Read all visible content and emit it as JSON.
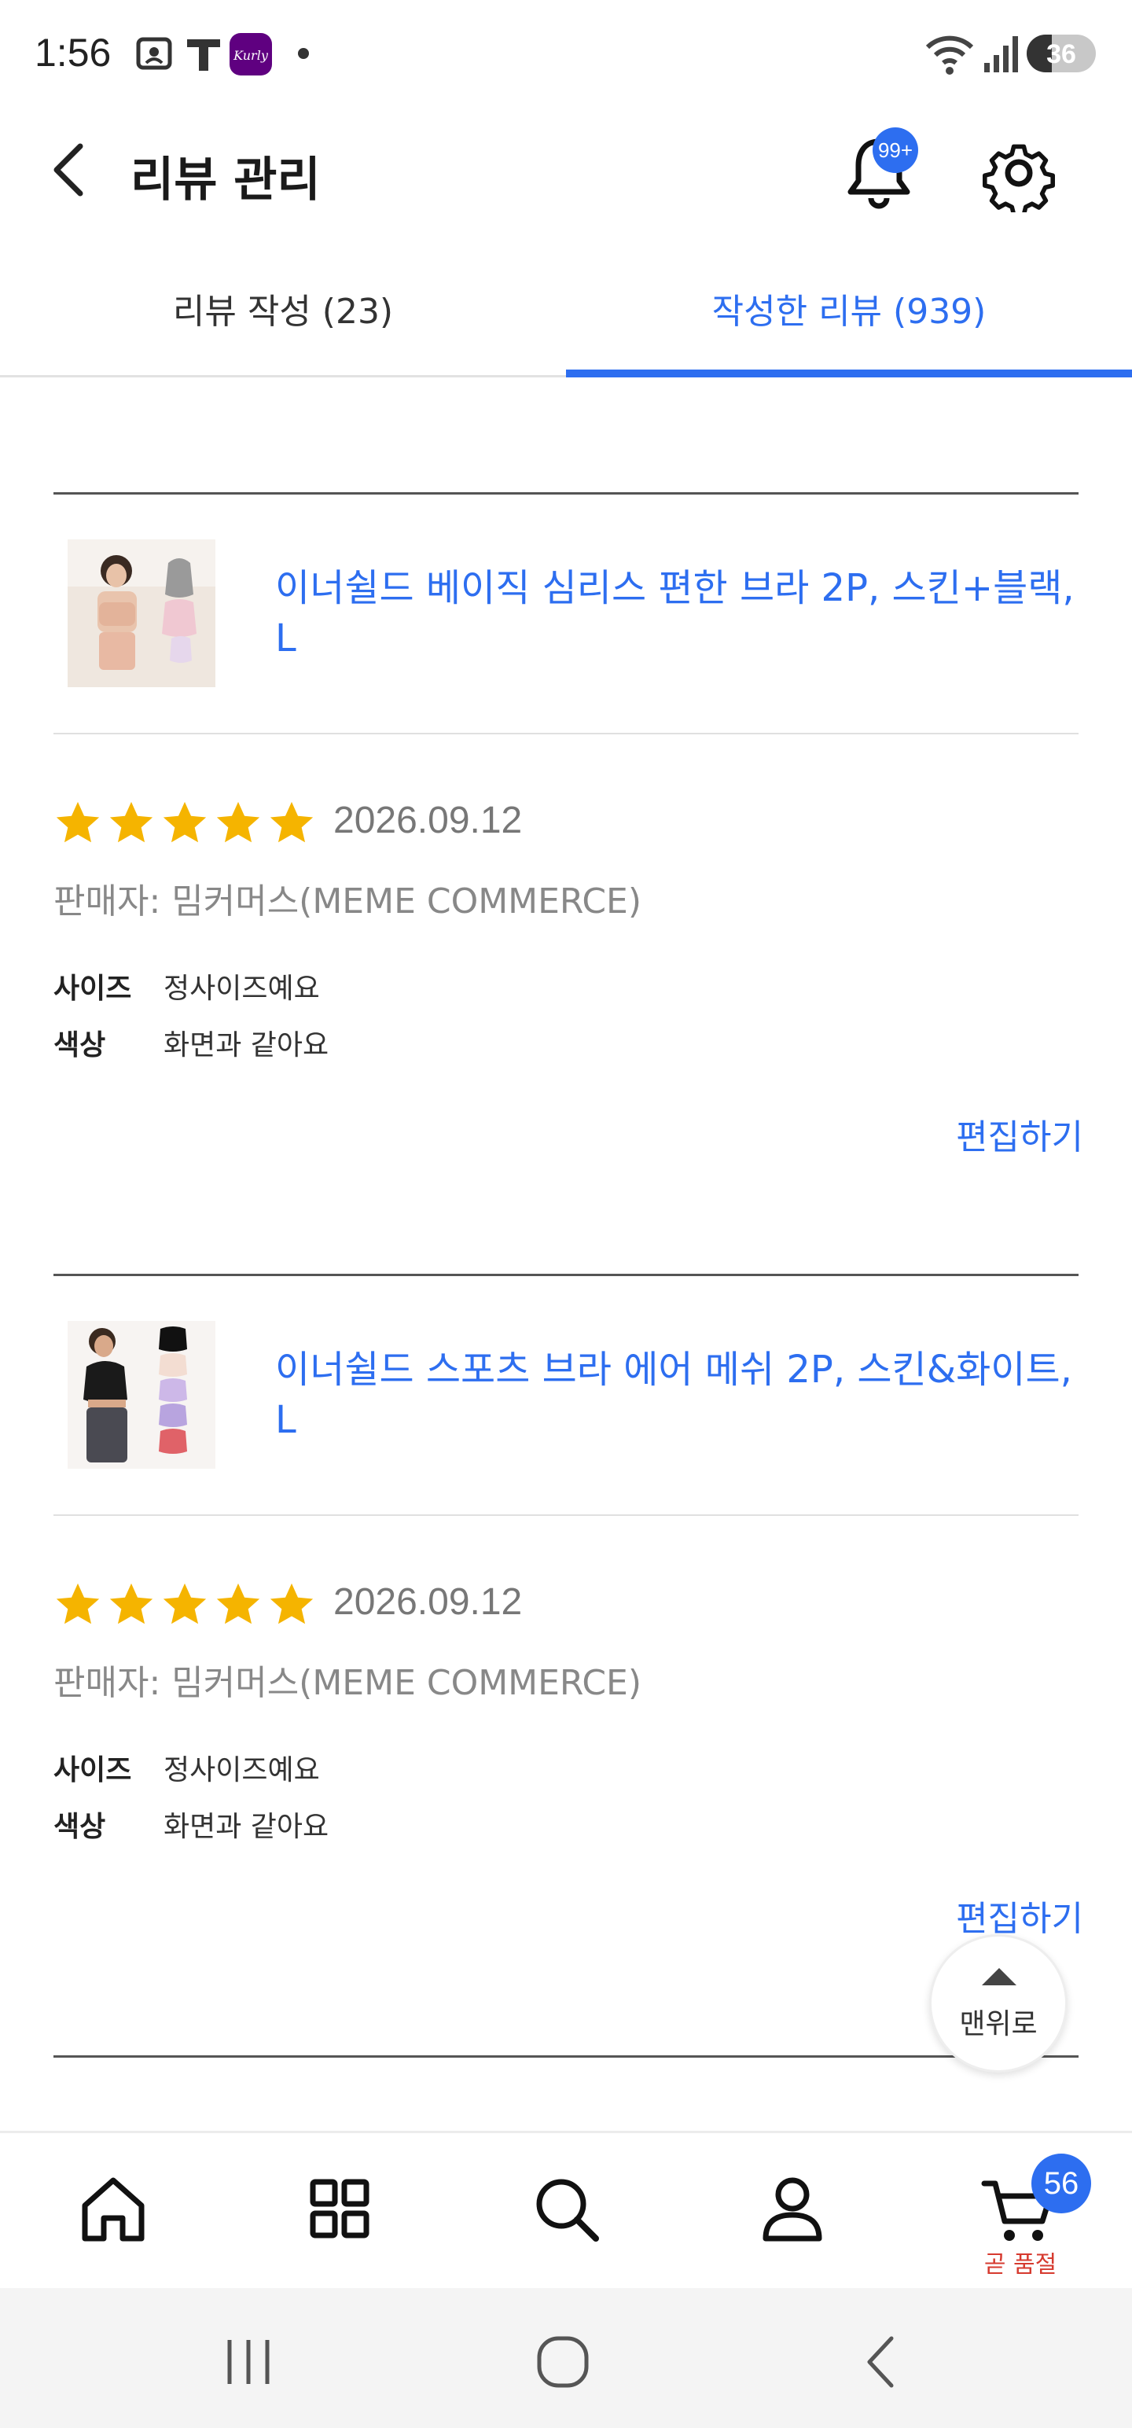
{
  "status_bar": {
    "time": "1:56",
    "battery": "36",
    "battery_level": 0.36
  },
  "header": {
    "title": "리뷰 관리",
    "notification_badge": "99+"
  },
  "tabs": [
    {
      "label": "리뷰 작성 (23)",
      "active": false
    },
    {
      "label": "작성한 리뷰 (939)",
      "active": true
    }
  ],
  "reviews": [
    {
      "product_name": "이너쉴드 베이직 심리스 편한 브라 2P, 스킨+블랙, L",
      "rating": 5,
      "date": "2026.09.12",
      "seller": "판매자: 밈커머스(MEME COMMERCE)",
      "options": [
        {
          "label": "사이즈",
          "value": "정사이즈예요"
        },
        {
          "label": "색상",
          "value": "화면과 같아요"
        }
      ],
      "edit_label": "편집하기"
    },
    {
      "product_name": "이너쉴드 스포츠 브라 에어 메쉬 2P, 스킨&화이트, L",
      "rating": 5,
      "date": "2026.09.12",
      "seller": "판매자: 밈커머스(MEME COMMERCE)",
      "options": [
        {
          "label": "사이즈",
          "value": "정사이즈예요"
        },
        {
          "label": "색상",
          "value": "화면과 같아요"
        }
      ],
      "edit_label": "편집하기"
    }
  ],
  "scroll_top": {
    "label": "맨위로"
  },
  "bottom_nav": {
    "items": [
      "home-icon",
      "category-grid-icon",
      "search-icon",
      "account-icon",
      "cart-icon"
    ],
    "cart_badge": "56",
    "cart_sub_label": "곧 품절"
  },
  "colors": {
    "accent": "#2d6ef0",
    "star": "#f5b400",
    "soldout": "#d63a2f"
  }
}
